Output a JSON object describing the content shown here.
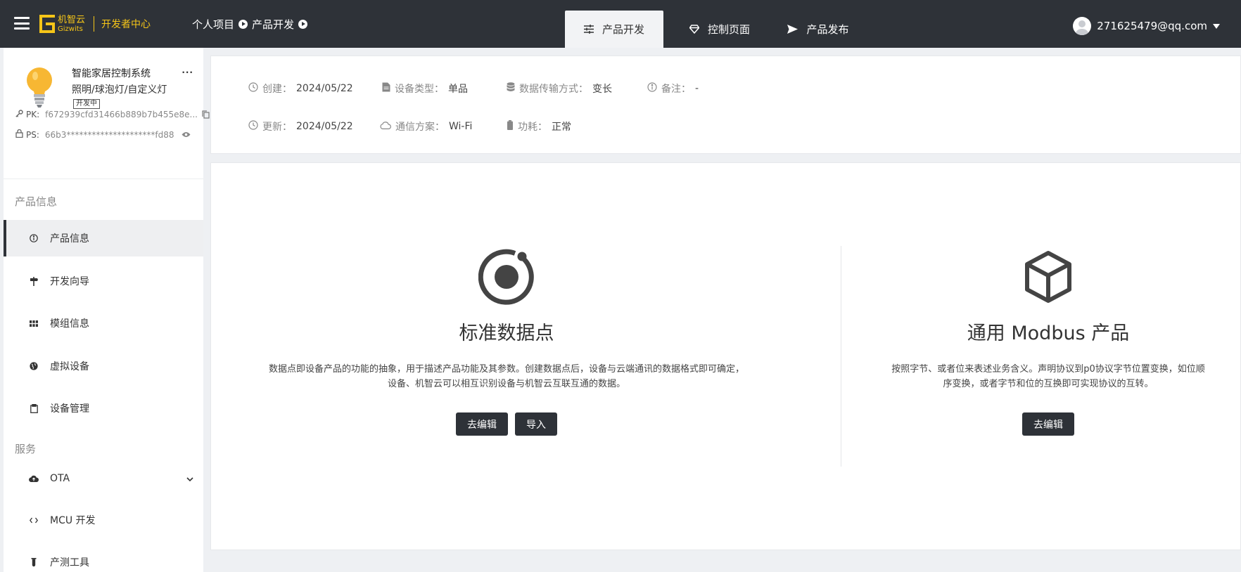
{
  "topbar": {
    "logo_cn": "机智云",
    "logo_en": "Gizwits",
    "logo_dev": "开发者中心",
    "breadcrumb": [
      "个人项目",
      "产品开发"
    ],
    "tabs": [
      {
        "label": "产品开发",
        "icon": "sliders-icon",
        "active": true
      },
      {
        "label": "控制页面",
        "icon": "diamond-icon",
        "active": false
      },
      {
        "label": "产品发布",
        "icon": "send-icon",
        "active": false
      }
    ],
    "user_email": "271625479@qq.com"
  },
  "product": {
    "name": "智能家居控制系统",
    "category": "照明/球泡灯/自定义灯",
    "status_badge": "开发中",
    "more": "···",
    "pk_label": "PK:",
    "pk_value": "f672939cfd31466b889b7b455e8e...",
    "ps_label": "PS:",
    "ps_value": "66b3*********************fd88"
  },
  "sidebar": {
    "section_product": "产品信息",
    "section_service": "服务",
    "items": [
      {
        "label": "产品信息",
        "icon": "info-icon",
        "active": true
      },
      {
        "label": "开发向导",
        "icon": "signpost-icon"
      },
      {
        "label": "模组信息",
        "icon": "grid-icon"
      },
      {
        "label": "虚拟设备",
        "icon": "globe-icon"
      },
      {
        "label": "设备管理",
        "icon": "clipboard-icon"
      },
      {
        "label": "OTA",
        "icon": "cloud-upload-icon"
      },
      {
        "label": "MCU 开发",
        "icon": "code-icon"
      },
      {
        "label": "产测工具",
        "icon": "test-tube-icon"
      }
    ]
  },
  "info": {
    "created_label": "创建：",
    "created_value": "2024/05/22",
    "device_type_label": "设备类型：",
    "device_type_value": "单品",
    "transfer_label": "数据传输方式：",
    "transfer_value": "变长",
    "note_label": "备注：",
    "note_value": "-",
    "updated_label": "更新：",
    "updated_value": "2024/05/22",
    "comm_label": "通信方案：",
    "comm_value": "Wi-Fi",
    "power_label": "功耗：",
    "power_value": "正常"
  },
  "features": {
    "standard": {
      "title": "标准数据点",
      "desc_line1": "数据点即设备产品的功能的抽象，用于描述产品功能及其参数。创建数据点后，设备与云端通讯的数据格式即可确定，",
      "desc_line2": "设备、机智云可以相互识别设备与机智云互联互通的数据。",
      "edit_button": "去编辑",
      "import_button": "导入"
    },
    "modbus": {
      "title": "通用 Modbus 产品",
      "desc_line1": "按照字节、或者位来表述业务含义。声明协议到p0协议字节位置变换，如位顺",
      "desc_line2": "序变换，或者字节和位的互换即可实现协议的互转。",
      "edit_button": "去编辑"
    }
  },
  "colors": {
    "topbar_bg": "#2e3238",
    "accent_yellow": "#f5c518",
    "button_bg": "#2e3238",
    "page_bg": "#eef0f3"
  }
}
